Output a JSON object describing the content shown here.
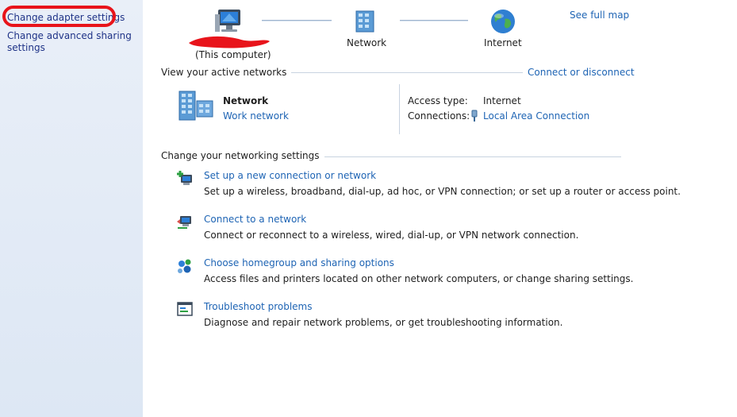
{
  "sidebar": {
    "links": [
      {
        "label": "Change adapter settings"
      },
      {
        "label_line1": "Change advanced sharing",
        "label_line2": "settings"
      }
    ],
    "highlight_color": "#e8141b"
  },
  "map": {
    "computer_label": "(This computer)",
    "network_label": "Network",
    "internet_label": "Internet",
    "see_full_map": "See full map"
  },
  "active_networks": {
    "title": "View your active networks",
    "connect_link": "Connect or disconnect",
    "network_name": "Network",
    "network_type": "Work network",
    "access_type_label": "Access type:",
    "access_type_value": "Internet",
    "connections_label": "Connections:",
    "connections_value": "Local Area Connection"
  },
  "settings": {
    "title": "Change your networking settings",
    "tasks": [
      {
        "icon": "new-connection-icon",
        "link": "Set up a new connection or network",
        "desc": "Set up a wireless, broadband, dial-up, ad hoc, or VPN connection; or set up a router or access point."
      },
      {
        "icon": "connect-network-icon",
        "link": "Connect to a network",
        "desc": "Connect or reconnect to a wireless, wired, dial-up, or VPN network connection."
      },
      {
        "icon": "homegroup-icon",
        "link": "Choose homegroup and sharing options",
        "desc": "Access files and printers located on other network computers, or change sharing settings."
      },
      {
        "icon": "troubleshoot-icon",
        "link": "Troubleshoot problems",
        "desc": "Diagnose and repair network problems, or get troubleshooting information."
      }
    ]
  },
  "colors": {
    "link": "#1e64b4",
    "sidebar_bg": "#e9eff8",
    "redaction": "#e8141b"
  }
}
